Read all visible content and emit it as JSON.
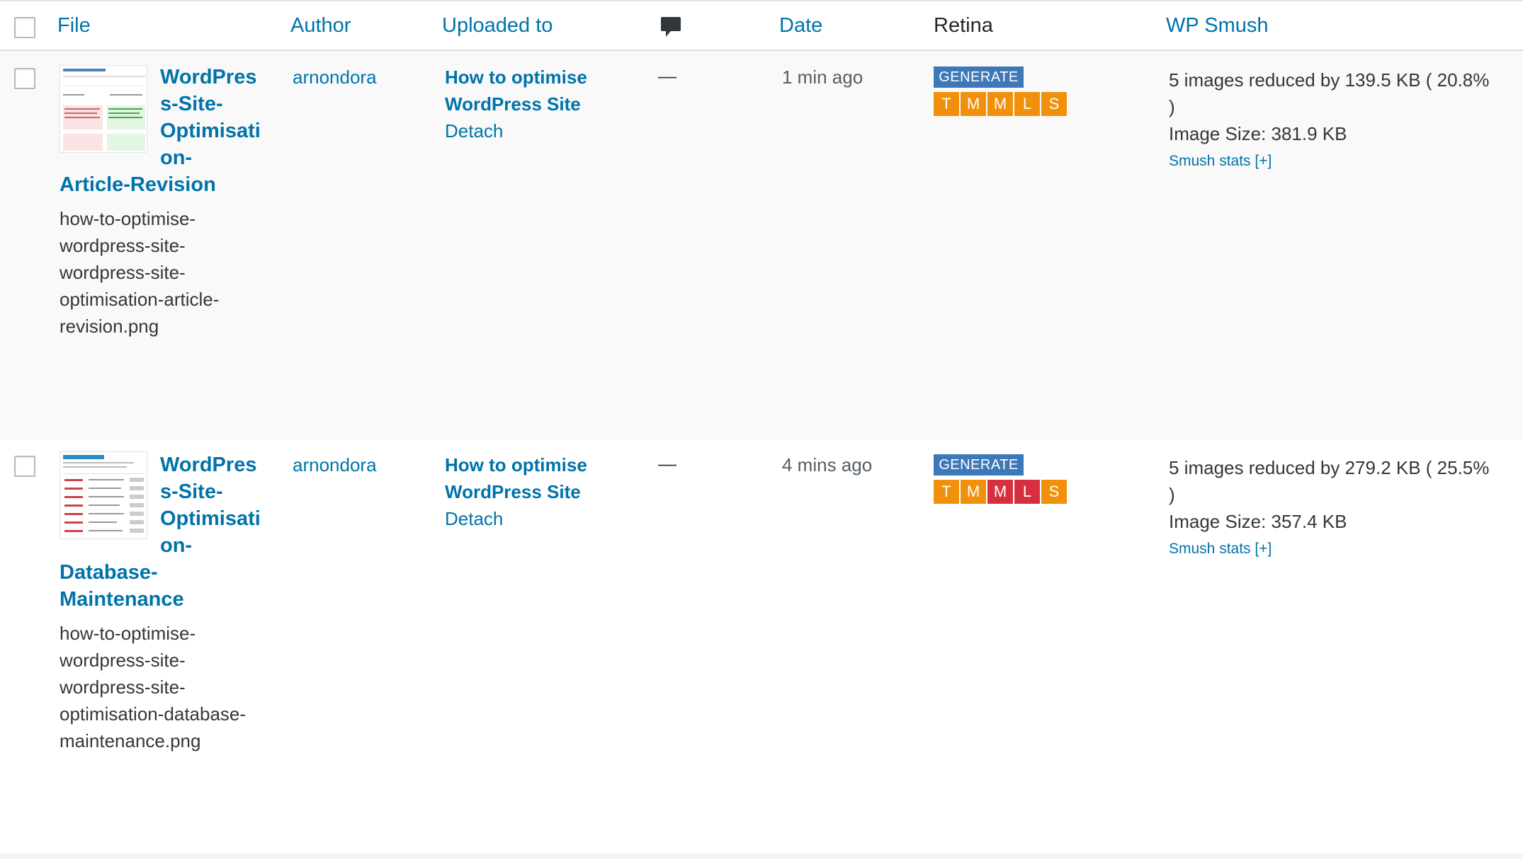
{
  "header": {
    "file": "File",
    "author": "Author",
    "uploaded_to": "Uploaded to",
    "comments_icon": "comment-bubble-icon",
    "date": "Date",
    "retina": "Retina",
    "wp_smush": "WP Smush"
  },
  "colors": {
    "link": "#0073aa",
    "generate_button": "#3d78b8",
    "size_orange": "#f0900b",
    "size_red": "#d6303f",
    "row_alt": "#f9f9f9"
  },
  "rows": [
    {
      "title_lines": [
        "WordPres",
        "s-Site-",
        "Optimisati",
        "on-",
        "Article-Revision"
      ],
      "filename_lines": [
        "how-to-optimise-",
        "wordpress-site-",
        "wordpress-site-",
        "optimisation-article-",
        "revision.png"
      ],
      "author": "arnondora",
      "post_lines": [
        "How to optimise",
        "WordPress Site"
      ],
      "detach": "Detach",
      "comments": "—",
      "date": "1 min ago",
      "generate": "GENERATE",
      "sizes": [
        {
          "label": "T",
          "state": "orange"
        },
        {
          "label": "M",
          "state": "orange"
        },
        {
          "label": "M",
          "state": "orange"
        },
        {
          "label": "L",
          "state": "orange"
        },
        {
          "label": "S",
          "state": "orange"
        }
      ],
      "smush_line1": "5 images reduced by 139.5 KB ( 20.8%",
      "smush_line2": ")",
      "image_size": "Image Size: 381.9 KB",
      "smush_stats": "Smush stats [+]"
    },
    {
      "title_lines": [
        "WordPres",
        "s-Site-",
        "Optimisati",
        "on-",
        "Database-",
        "Maintenance"
      ],
      "filename_lines": [
        "how-to-optimise-",
        "wordpress-site-",
        "wordpress-site-",
        "optimisation-database-",
        "maintenance.png"
      ],
      "author": "arnondora",
      "post_lines": [
        "How to optimise",
        "WordPress Site"
      ],
      "detach": "Detach",
      "comments": "—",
      "date": "4 mins ago",
      "generate": "GENERATE",
      "sizes": [
        {
          "label": "T",
          "state": "orange"
        },
        {
          "label": "M",
          "state": "orange"
        },
        {
          "label": "M",
          "state": "red"
        },
        {
          "label": "L",
          "state": "red"
        },
        {
          "label": "S",
          "state": "orange"
        }
      ],
      "smush_line1": "5 images reduced by 279.2 KB ( 25.5%",
      "smush_line2": ")",
      "image_size": "Image Size: 357.4 KB",
      "smush_stats": "Smush stats [+]"
    }
  ]
}
